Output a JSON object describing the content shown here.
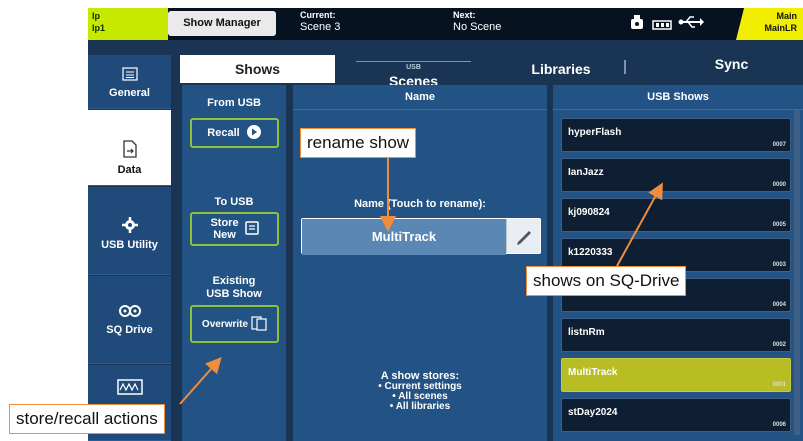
{
  "topbar": {
    "left_channel": [
      "Ip",
      "Ip1"
    ],
    "show_manager_label": "Show Manager",
    "current_label": "Current:",
    "current_value": "Scene 3",
    "next_label": "Next:",
    "next_value": "No Scene",
    "right_channel": [
      "Main",
      "MainLR"
    ]
  },
  "sidebar": {
    "items": [
      {
        "label": "General",
        "icon": "list-icon"
      },
      {
        "label": "Data",
        "icon": "document-usb-icon"
      },
      {
        "label": "USB Utility",
        "icon": "gear-icon"
      },
      {
        "label": "SQ Drive",
        "icon": "tape-icon"
      }
    ]
  },
  "tabs": {
    "shows": "Shows",
    "scenes_sub": "USB",
    "scenes": "Scenes",
    "libraries": "Libraries",
    "sync": "Sync"
  },
  "actions": {
    "from_usb": "From USB",
    "recall": "Recall",
    "to_usb": "To USB",
    "store_new_1": "Store",
    "store_new_2": "New",
    "existing_1": "Existing",
    "existing_2": "USB Show",
    "overwrite": "Overwrite"
  },
  "name_panel": {
    "header": "Name",
    "rename_label": "Name (Touch to rename):",
    "show_name": "MultiTrack",
    "info": [
      "A show stores:",
      "• Current settings",
      "• All scenes",
      "• All libraries"
    ]
  },
  "usb_shows": {
    "header": "USB Shows",
    "items": [
      {
        "name": "hyperFlash",
        "num": "0007",
        "selected": false
      },
      {
        "name": "IanJazz",
        "num": "0000",
        "selected": false
      },
      {
        "name": "kj090824",
        "num": "0005",
        "selected": false
      },
      {
        "name": "k1220333",
        "num": "0003",
        "selected": false
      },
      {
        "name": "",
        "num": "0004",
        "selected": false
      },
      {
        "name": "listnRm",
        "num": "0002",
        "selected": false
      },
      {
        "name": "MultiTrack",
        "num": "0001",
        "selected": true
      },
      {
        "name": "stDay2024",
        "num": "0006",
        "selected": false
      }
    ]
  },
  "callouts": {
    "rename": "rename show",
    "shows": "shows on SQ-Drive",
    "actions": "store/recall actions"
  },
  "colors": {
    "accent_green": "#8fc03a",
    "selected_item": "#b7bd22",
    "callout_border": "#ef8d3c",
    "arrow": "#ef8d3c"
  }
}
